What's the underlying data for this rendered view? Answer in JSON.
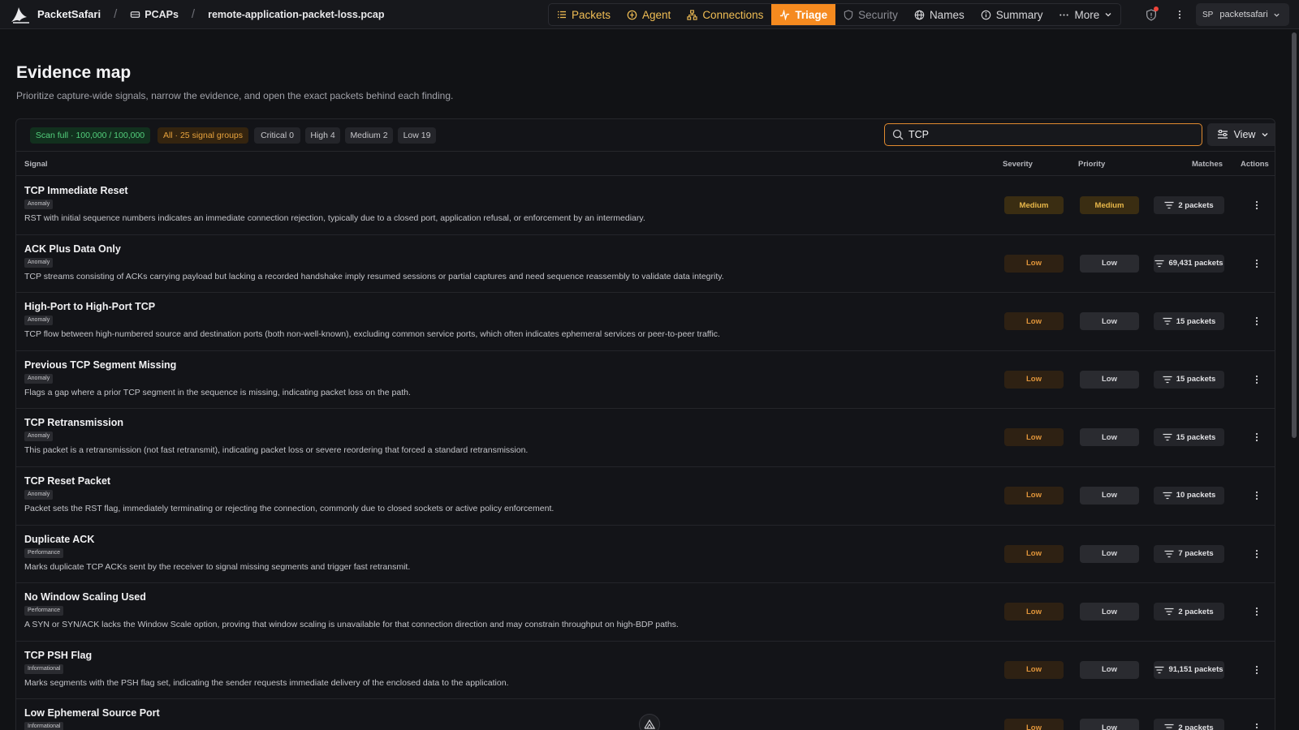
{
  "topbar": {
    "app_name": "PacketSafari",
    "breadcrumb_pcaps": "PCAPs",
    "breadcrumb_file": "remote-application-packet-loss.pcap",
    "nav": [
      {
        "label": "Packets",
        "icon": "list-icon"
      },
      {
        "label": "Agent",
        "icon": "agent-icon"
      },
      {
        "label": "Connections",
        "icon": "network-icon"
      },
      {
        "label": "Triage",
        "icon": "activity-icon",
        "active": true
      },
      {
        "label": "Security",
        "icon": "shield-icon"
      },
      {
        "label": "Names",
        "icon": "globe-icon"
      },
      {
        "label": "Summary",
        "icon": "info-icon"
      },
      {
        "label": "More",
        "icon": "ellipsis-icon"
      }
    ],
    "user_initials": "SP",
    "user_name": "packetsafari"
  },
  "page": {
    "title": "Evidence map",
    "subtitle": "Prioritize capture-wide signals, narrow the evidence, and open the exact packets behind each finding."
  },
  "filters": {
    "scan": "Scan full · 100,000 / 100,000",
    "all": "All · 25 signal groups",
    "critical": "Critical 0",
    "high": "High 4",
    "medium": "Medium 2",
    "low": "Low 19"
  },
  "search": {
    "value": "TCP",
    "placeholder": ""
  },
  "view_label": "View",
  "columns": {
    "signal": "Signal",
    "severity": "Severity",
    "priority": "Priority",
    "matches": "Matches",
    "actions": "Actions"
  },
  "rows": [
    {
      "title": "TCP Immediate Reset",
      "tag": "Anomaly",
      "desc": "RST with initial sequence numbers indicates an immediate connection rejection, typically due to a closed port, application refusal, or enforcement by an intermediary.",
      "severity": "Medium",
      "priority": "Medium",
      "matches": "2 packets"
    },
    {
      "title": "ACK Plus Data Only",
      "tag": "Anomaly",
      "desc": "TCP streams consisting of ACKs carrying payload but lacking a recorded handshake imply resumed sessions or partial captures and need sequence reassembly to validate data integrity.",
      "severity": "Low",
      "priority": "Low",
      "matches": "69,431 packets"
    },
    {
      "title": "High-Port to High-Port TCP",
      "tag": "Anomaly",
      "desc": "TCP flow between high-numbered source and destination ports (both non-well-known), excluding common service ports, which often indicates ephemeral services or peer-to-peer traffic.",
      "severity": "Low",
      "priority": "Low",
      "matches": "15 packets"
    },
    {
      "title": "Previous TCP Segment Missing",
      "tag": "Anomaly",
      "desc": "Flags a gap where a prior TCP segment in the sequence is missing, indicating packet loss on the path.",
      "severity": "Low",
      "priority": "Low",
      "matches": "15 packets"
    },
    {
      "title": "TCP Retransmission",
      "tag": "Anomaly",
      "desc": "This packet is a retransmission (not fast retransmit), indicating packet loss or severe reordering that forced a standard retransmission.",
      "severity": "Low",
      "priority": "Low",
      "matches": "15 packets"
    },
    {
      "title": "TCP Reset Packet",
      "tag": "Anomaly",
      "desc": "Packet sets the RST flag, immediately terminating or rejecting the connection, commonly due to closed sockets or active policy enforcement.",
      "severity": "Low",
      "priority": "Low",
      "matches": "10 packets"
    },
    {
      "title": "Duplicate ACK",
      "tag": "Performance",
      "desc": "Marks duplicate TCP ACKs sent by the receiver to signal missing segments and trigger fast retransmit.",
      "severity": "Low",
      "priority": "Low",
      "matches": "7 packets"
    },
    {
      "title": "No Window Scaling Used",
      "tag": "Performance",
      "desc": "A SYN or SYN/ACK lacks the Window Scale option, proving that window scaling is unavailable for that connection direction and may constrain throughput on high-BDP paths.",
      "severity": "Low",
      "priority": "Low",
      "matches": "2 packets"
    },
    {
      "title": "TCP PSH Flag",
      "tag": "Informational",
      "desc": "Marks segments with the PSH flag set, indicating the sender requests immediate delivery of the enclosed data to the application.",
      "severity": "Low",
      "priority": "Low",
      "matches": "91,151 packets"
    },
    {
      "title": "Low Ephemeral Source Port",
      "tag": "Informational",
      "desc": "",
      "severity": "Low",
      "priority": "Low",
      "matches": "2 packets"
    }
  ]
}
